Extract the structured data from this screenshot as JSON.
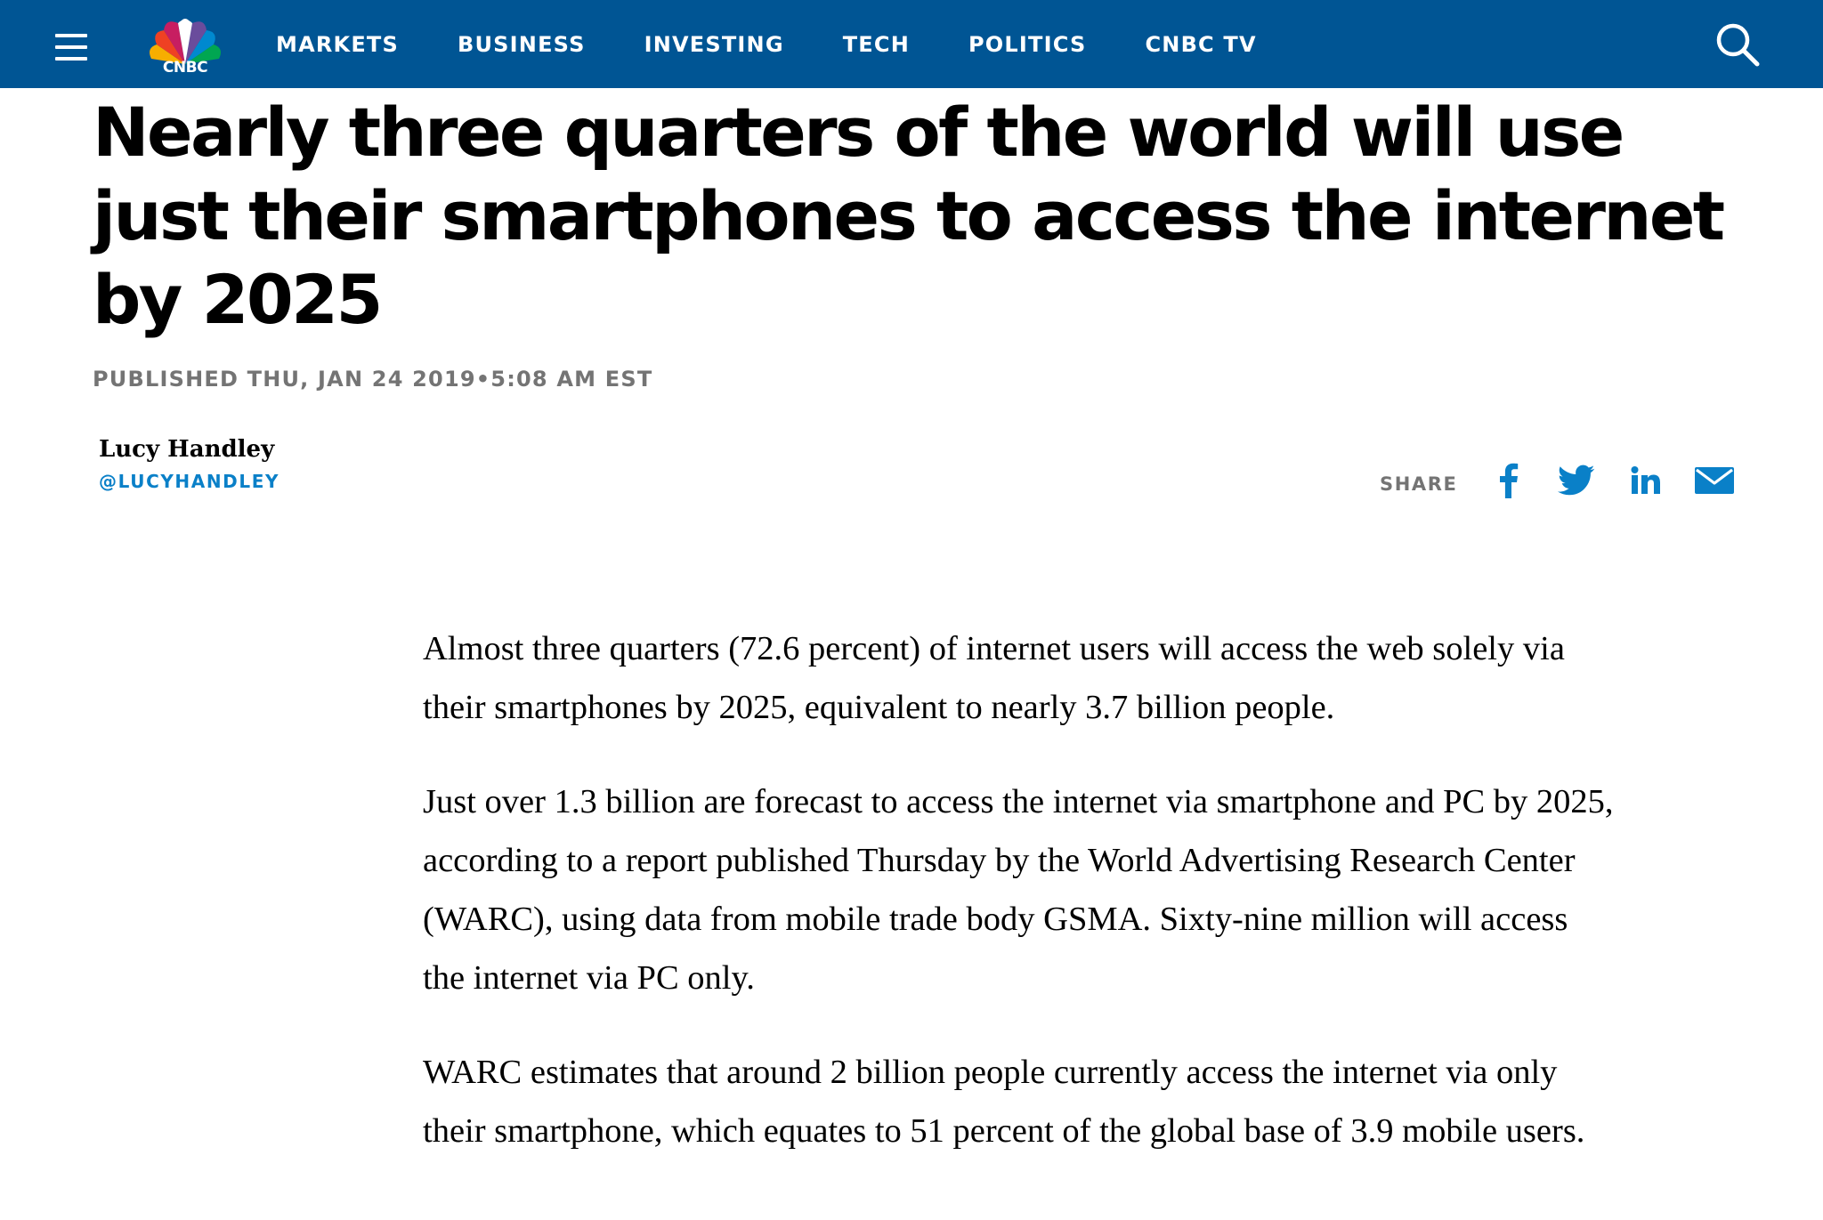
{
  "site": {
    "logo_text": "CNBC",
    "brand_color": "#005594",
    "accent_color": "#0a80c8"
  },
  "nav": {
    "menu_icon": "hamburger-menu-icon",
    "items": [
      {
        "label": "MARKETS"
      },
      {
        "label": "BUSINESS"
      },
      {
        "label": "INVESTING"
      },
      {
        "label": "TECH"
      },
      {
        "label": "POLITICS"
      },
      {
        "label": "CNBC TV"
      }
    ],
    "search_icon": "search-icon"
  },
  "article": {
    "headline": "Nearly three quarters of the world will use just their smartphones to access the internet by 2025",
    "published": "PUBLISHED THU, JAN 24 2019•5:08 AM EST",
    "author": {
      "name": "Lucy Handley",
      "handle": "@LUCYHANDLEY"
    },
    "share": {
      "label": "SHARE",
      "icons": [
        "facebook-icon",
        "twitter-icon",
        "linkedin-icon",
        "email-icon"
      ]
    },
    "paragraphs": [
      "Almost three quarters (72.6 percent) of internet users will access the web solely via their smartphones by 2025, equivalent to nearly 3.7 billion people.",
      "Just over 1.3 billion are forecast to access the internet via smartphone and PC by 2025, according to a report published Thursday by the World Advertising Research Center (WARC), using data from mobile trade body GSMA. Sixty-nine million will access the internet via PC only.",
      "WARC estimates that around 2 billion people currently access the internet via only their smartphone, which equates to 51 percent of the global base of 3.9 mobile users."
    ]
  }
}
